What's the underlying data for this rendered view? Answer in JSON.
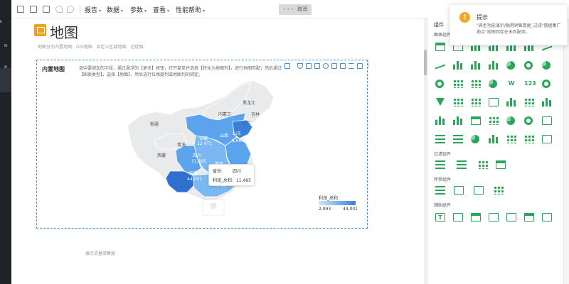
{
  "toolbar": {
    "menus": [
      "报告",
      "数据",
      "参数",
      "查看",
      "性能帮助"
    ],
    "cancel_label": "取消"
  },
  "sidebar": {
    "labels": [
      "k"
    ]
  },
  "page": {
    "title": "地图",
    "subtitle": "地图分为内置地图、GIS地图、自定义区域地图、迁徙图。",
    "hint": "展示流量密集度"
  },
  "widget": {
    "title": "内置地图",
    "description": "选中要绑定的字段，通过悬浮的【更多】按钮，打开菜单并选择【转化为地图列】，进行地图匹配；然后通过【图表类型】，选择【地图】，然后进行拉拽度列或地图列的绑定。",
    "map_labels": {
      "heilongjiang": "黑龙江",
      "neimenggu": "内蒙古",
      "jilin": "吉林",
      "liaoning": "辽宁",
      "xinjiang": "新疆",
      "qinghai": "青海",
      "xizang": "西藏",
      "anhui": "安徽",
      "shanxi": "山西",
      "shandong": "山东",
      "sichuan": "四川",
      "chongqing": "重庆",
      "yunnan": "云南",
      "guangxi": "广西"
    },
    "map_values": {
      "anhui": "12,471",
      "shandong": "8,666",
      "sichuan": "11,495",
      "yunnan": "44,001"
    },
    "tooltip": {
      "province_label": "省份:",
      "province_value": "四川",
      "metric_label": "利润_总和:",
      "metric_value": "11,495"
    },
    "legend": {
      "title": "利润_总和",
      "min": "2,993",
      "max": "44,001",
      "min_value": 2993,
      "max_value": 44001
    }
  },
  "components": {
    "header": "组件",
    "sections": [
      "图表组件",
      "过滤组件",
      "传参组件",
      "辅助组件"
    ],
    "accent_color": "#2aa55a"
  },
  "notification": {
    "icon": "!",
    "title": "提示",
    "message": "\"典型功能演示/融得销售数据_过滤\"数据集广地点\"地图列存在未匹配项。"
  },
  "colors": {
    "map_dark": "#3a7fdb",
    "map_mid": "#5ba3ec",
    "map_light": "#9fcdf7",
    "map_gray": "#e9eaec",
    "selection": "#4a8bd8",
    "title_icon": "#f0a020"
  }
}
